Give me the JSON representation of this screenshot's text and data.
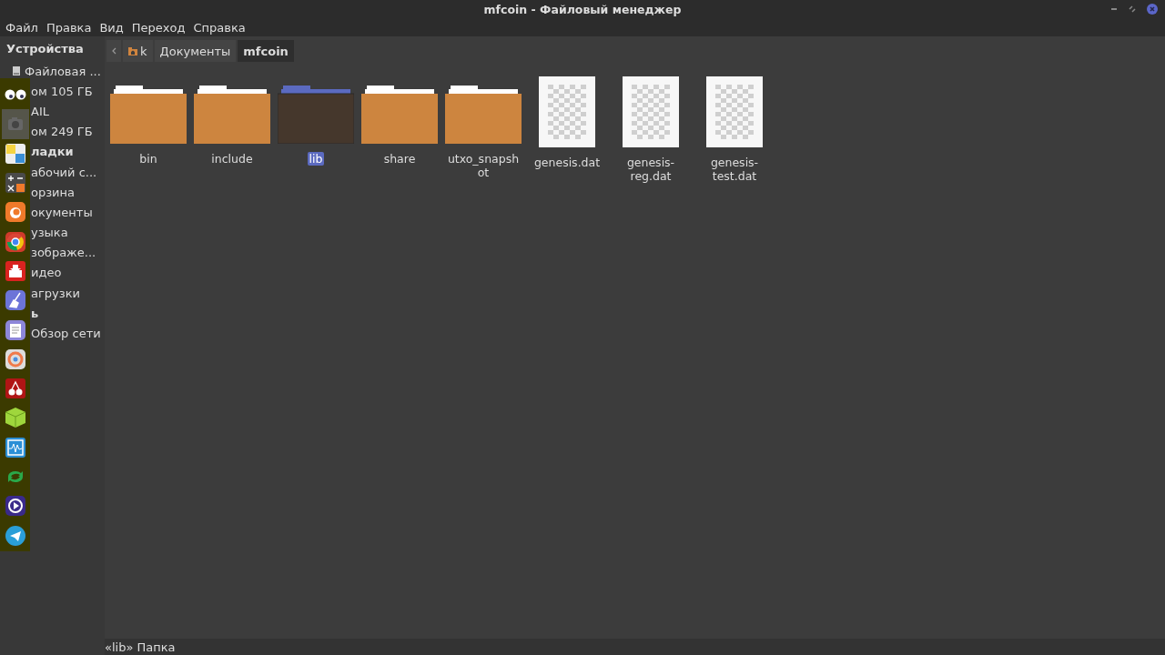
{
  "window": {
    "title": "mfcoin - Файловый менеджер"
  },
  "menu": [
    "Файл",
    "Правка",
    "Вид",
    "Переход",
    "Справка"
  ],
  "sidebar": {
    "heading": "Устройства",
    "items": [
      {
        "label": "Файловая ...",
        "kind": "drive"
      },
      {
        "label": "ом 105 ГБ",
        "kind": "plain"
      },
      {
        "label": "AIL",
        "kind": "plain"
      },
      {
        "label": "ом 249 ГБ",
        "kind": "plain"
      },
      {
        "label": "ладки",
        "kind": "heading"
      },
      {
        "label": "абочий с...",
        "kind": "plain"
      },
      {
        "label": "орзина",
        "kind": "plain"
      },
      {
        "label": "окументы",
        "kind": "plain"
      },
      {
        "label": "узыка",
        "kind": "plain"
      },
      {
        "label": "зображе...",
        "kind": "plain"
      },
      {
        "label": "идео",
        "kind": "plain"
      },
      {
        "label": "агрузки",
        "kind": "plain"
      },
      {
        "label": "ь",
        "kind": "heading"
      },
      {
        "label": "Обзор сети",
        "kind": "plain"
      }
    ]
  },
  "breadcrumbs": [
    {
      "label": "k",
      "kind": "home",
      "selected": false
    },
    {
      "label": "Документы",
      "kind": "folder",
      "selected": false
    },
    {
      "label": "mfcoin",
      "kind": "folder",
      "selected": true
    }
  ],
  "files": [
    {
      "name": "bin",
      "kind": "folder",
      "selected": false
    },
    {
      "name": "include",
      "kind": "folder",
      "selected": false
    },
    {
      "name": "lib",
      "kind": "folder",
      "selected": true
    },
    {
      "name": "share",
      "kind": "folder",
      "selected": false
    },
    {
      "name": "utxo_snapsh ot",
      "kind": "folder",
      "selected": false
    },
    {
      "name": "genesis.dat",
      "kind": "file",
      "selected": false
    },
    {
      "name": "genesis- reg.dat",
      "kind": "file",
      "selected": false
    },
    {
      "name": "genesis- test.dat",
      "kind": "file",
      "selected": false
    }
  ],
  "status_bar": "«lib» Папка"
}
